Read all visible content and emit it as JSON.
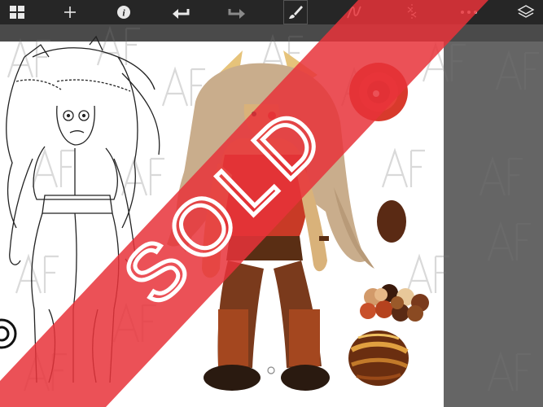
{
  "toolbar": {
    "items": [
      {
        "name": "gallery-icon"
      },
      {
        "name": "add-icon",
        "glyph": "+"
      },
      {
        "name": "info-icon",
        "glyph": "i"
      },
      {
        "name": "undo-icon"
      },
      {
        "name": "redo-icon"
      },
      {
        "name": "brush-icon"
      },
      {
        "name": "stroke-icon"
      },
      {
        "name": "symmetry-icon"
      },
      {
        "name": "more-icon",
        "glyph": "•••"
      },
      {
        "name": "layers-icon"
      }
    ],
    "active_tool": "brush-icon"
  },
  "artwork": {
    "watermark": "AFp",
    "overlay_text": "SOLD",
    "colors": {
      "banner": "#e8323a",
      "skin": "#d9b27a",
      "hair": "#c9ad8c",
      "gem": "#d83a2c",
      "brown": "#5a2e14",
      "paper": "#ffffff",
      "toolbar_bg": "#262626",
      "canvas_bg": "#656565"
    },
    "palette_swatches": [
      "#e8c89a",
      "#5a2a14",
      "#c8502a",
      "#e6b888",
      "#b5421e",
      "#7a3a1c",
      "#3a1a0c",
      "#8a4a22",
      "#d29a6a",
      "#9a5a2a"
    ]
  }
}
